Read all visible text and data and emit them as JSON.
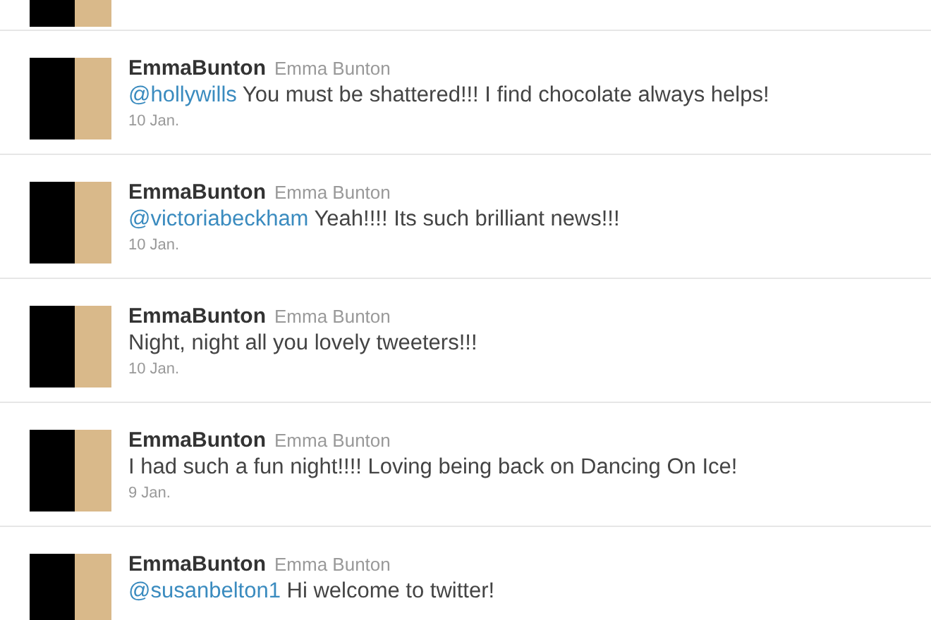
{
  "tweets": [
    {
      "username": "EmmaBunton",
      "full_name": "Emma Bunton",
      "mention": "@hollywills",
      "text": "You must be shattered!!! I find chocolate always helps!",
      "date": "10 Jan."
    },
    {
      "username": "EmmaBunton",
      "full_name": "Emma Bunton",
      "mention": "@victoriabeckham",
      "text": "Yeah!!!! Its such brilliant news!!!",
      "date": "10 Jan."
    },
    {
      "username": "EmmaBunton",
      "full_name": "Emma Bunton",
      "text": "Night, night all you lovely tweeters!!!",
      "date": "10 Jan."
    },
    {
      "username": "EmmaBunton",
      "full_name": "Emma Bunton",
      "text": "I had such a fun night!!!! Loving being back on Dancing On Ice!",
      "date": "9 Jan."
    },
    {
      "username": "EmmaBunton",
      "full_name": "Emma Bunton",
      "mention": "@susanbelton1",
      "text": "Hi welcome to twitter!"
    }
  ]
}
